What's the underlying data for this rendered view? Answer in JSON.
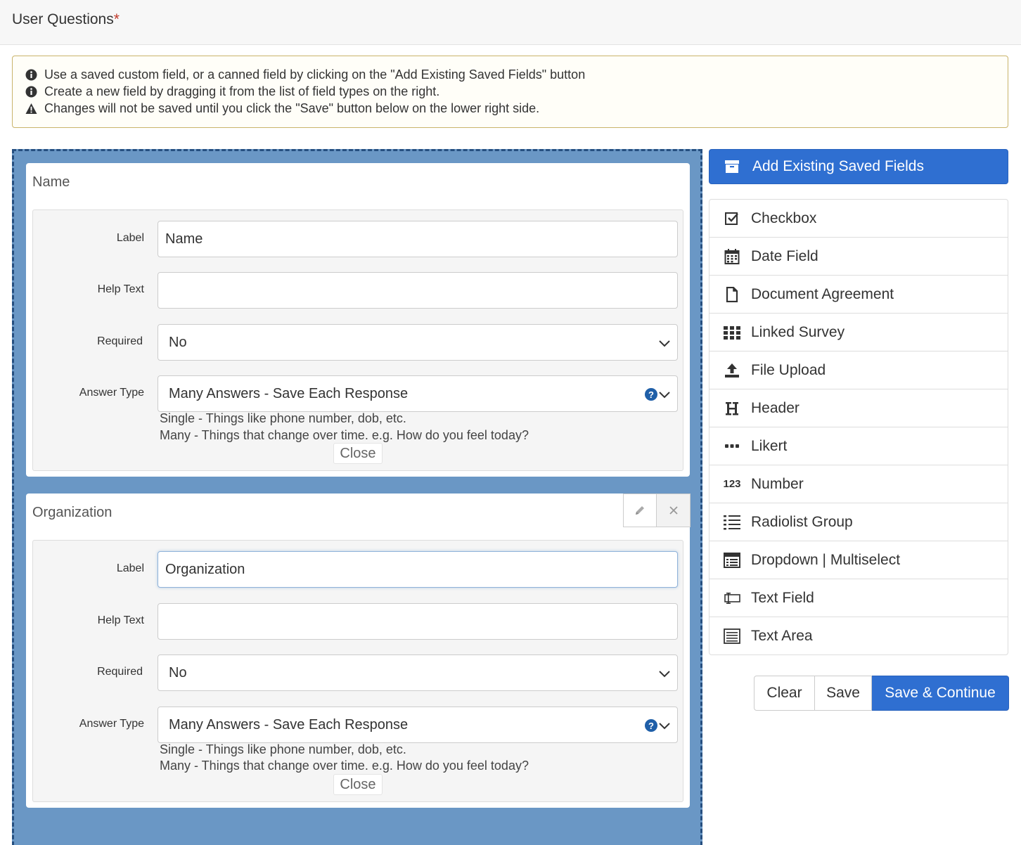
{
  "header": {
    "title": "User Questions",
    "required_mark": "*"
  },
  "notice": {
    "lines": [
      {
        "icon": "info-circle-icon",
        "text": "Use a saved custom field, or a canned field by clicking on the \"Add Existing Saved Fields\" button"
      },
      {
        "icon": "info-circle-icon",
        "text": "Create a new field by dragging it from the list of field types on the right."
      },
      {
        "icon": "warning-triangle-icon",
        "text": "Changes will not be saved until you click the \"Save\" button below on the lower right side."
      }
    ]
  },
  "form_fields": [
    {
      "title": "Name",
      "label_caption": "Label",
      "label_value": "Name",
      "help_caption": "Help Text",
      "help_value": "",
      "required_caption": "Required",
      "required_value": "No",
      "answer_caption": "Answer Type",
      "answer_value": "Many Answers - Save Each Response",
      "hint_single": "Single - Things like phone number, dob, etc.",
      "hint_many": "Many - Things that change over time. e.g. How do you feel today?",
      "close_label": "Close"
    },
    {
      "title": "Organization",
      "label_caption": "Label",
      "label_value": "Organization",
      "help_caption": "Help Text",
      "help_value": "",
      "required_caption": "Required",
      "required_value": "No",
      "answer_caption": "Answer Type",
      "answer_value": "Many Answers - Save Each Response",
      "hint_single": "Single - Things like phone number, dob, etc.",
      "hint_many": "Many - Things that change over time. e.g. How do you feel today?",
      "close_label": "Close"
    }
  ],
  "sidebar": {
    "add_button": "Add Existing Saved Fields",
    "field_types": [
      {
        "label": "Checkbox",
        "icon": "checkbox-icon"
      },
      {
        "label": "Date Field",
        "icon": "calendar-icon"
      },
      {
        "label": "Document Agreement",
        "icon": "document-icon"
      },
      {
        "label": "Linked Survey",
        "icon": "grid-icon"
      },
      {
        "label": "File Upload",
        "icon": "upload-icon"
      },
      {
        "label": "Header",
        "icon": "header-icon"
      },
      {
        "label": "Likert",
        "icon": "ellipsis-icon"
      },
      {
        "label": "Number",
        "icon": "number-icon"
      },
      {
        "label": "Radiolist Group",
        "icon": "list-icon"
      },
      {
        "label": "Dropdown | Multiselect",
        "icon": "dropdown-icon"
      },
      {
        "label": "Text Field",
        "icon": "text-field-icon"
      },
      {
        "label": "Text Area",
        "icon": "text-area-icon"
      }
    ]
  },
  "actions": {
    "clear": "Clear",
    "save": "Save",
    "save_continue": "Save & Continue"
  },
  "colors": {
    "primary": "#2f6fd1",
    "dropzone": "#6a97c5",
    "dropzone_border": "#264f80",
    "required_mark": "#c0392b",
    "notice_border": "#c9b36a"
  }
}
